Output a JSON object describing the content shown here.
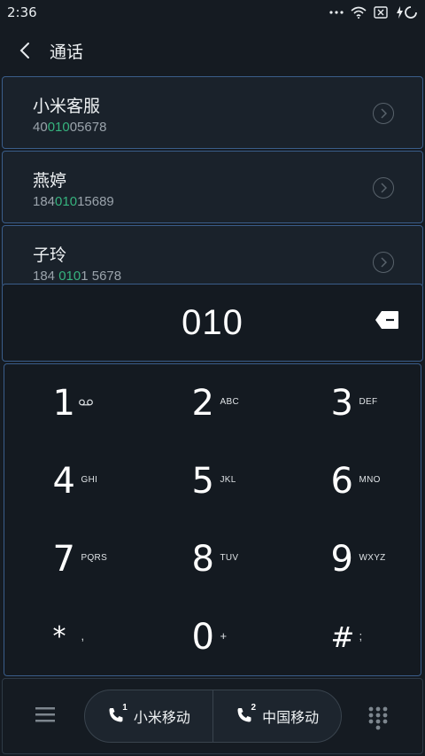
{
  "status_bar": {
    "time": "2:36"
  },
  "header": {
    "title": "通话"
  },
  "contacts": [
    {
      "name": "小米客服",
      "number_before": "40",
      "number_match": "010",
      "number_after": "05678"
    },
    {
      "name": "燕婷",
      "number_before": "184",
      "number_match": "010",
      "number_after": "15689"
    },
    {
      "name": "子玲",
      "number_before": "184 ",
      "number_match": "010",
      "number_after": "1 5678"
    }
  ],
  "dialer": {
    "input": "010"
  },
  "keypad": {
    "keys": [
      {
        "digit": "1",
        "letters": "",
        "icon": "voicemail-icon"
      },
      {
        "digit": "2",
        "letters": "ABC"
      },
      {
        "digit": "3",
        "letters": "DEF"
      },
      {
        "digit": "4",
        "letters": "GHI"
      },
      {
        "digit": "5",
        "letters": "JKL"
      },
      {
        "digit": "6",
        "letters": "MNO"
      },
      {
        "digit": "7",
        "letters": "PQRS"
      },
      {
        "digit": "8",
        "letters": "TUV"
      },
      {
        "digit": "9",
        "letters": "WXYZ"
      },
      {
        "digit": "*",
        "letters": ","
      },
      {
        "digit": "0",
        "letters": "+"
      },
      {
        "digit": "#",
        "letters": ";"
      }
    ]
  },
  "bottom_bar": {
    "sim1": {
      "label": "小米移动",
      "slot": "1"
    },
    "sim2": {
      "label": "中国移动",
      "slot": "2"
    }
  },
  "colors": {
    "match_highlight": "#36b37e",
    "border_accent": "#3a5d8a",
    "background": "#151b22"
  }
}
